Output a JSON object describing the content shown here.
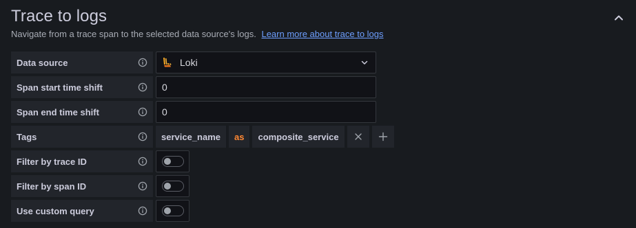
{
  "section": {
    "title": "Trace to logs",
    "description": "Navigate from a trace span to the selected data source's logs.",
    "learn_more_link": "Learn more about trace to logs"
  },
  "fields": {
    "data_source": {
      "label": "Data source",
      "value": "Loki"
    },
    "span_start": {
      "label": "Span start time shift",
      "value": "0"
    },
    "span_end": {
      "label": "Span end time shift",
      "value": "0"
    },
    "tags": {
      "label": "Tags",
      "key": "service_name",
      "operator": "as",
      "alias": "composite_service"
    },
    "filter_trace_id": {
      "label": "Filter by trace ID",
      "enabled": false
    },
    "filter_span_id": {
      "label": "Filter by span ID",
      "enabled": false
    },
    "custom_query": {
      "label": "Use custom query",
      "enabled": false
    }
  },
  "colors": {
    "background": "#181b1f",
    "label_bg": "#22252b",
    "link": "#6e9fff",
    "operator": "#ff8833",
    "loki_logo": "#f5a623"
  },
  "icons": [
    "chevron-up-icon",
    "info-icon",
    "loki-logo-icon",
    "chevron-down-icon",
    "close-icon",
    "plus-icon"
  ]
}
